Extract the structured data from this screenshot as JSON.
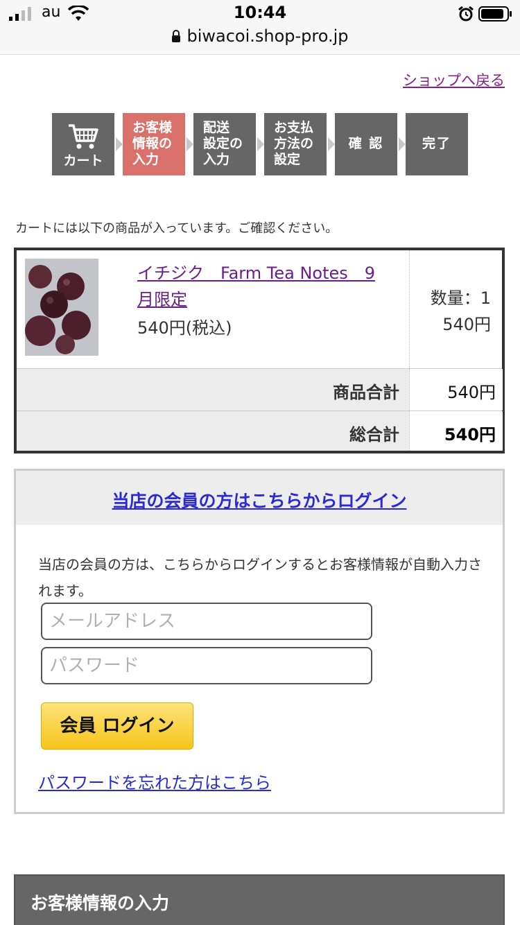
{
  "status_bar": {
    "carrier": "au",
    "time": "10:44",
    "url": "biwacoi.shop-pro.jp"
  },
  "header": {
    "back_link": "ショップへ戻る"
  },
  "steps": [
    {
      "label": "カート"
    },
    {
      "label_lines": [
        "お客様",
        "情報の",
        "入力"
      ],
      "active": true
    },
    {
      "label_lines": [
        "配送",
        "設定の",
        "入力"
      ]
    },
    {
      "label_lines": [
        "お支払",
        "方法の",
        "設定"
      ]
    },
    {
      "label": "確 認"
    },
    {
      "label": "完了"
    }
  ],
  "cart": {
    "intro": "カートには以下の商品が入っています。ご確認ください。",
    "item": {
      "name_line1": "イチジク　Farm Tea Notes　9",
      "name_line2": "月限定",
      "price": "540円(税込)",
      "quantity": "数量：1",
      "subtotal": "540円"
    },
    "product_total_label": "商品合計",
    "product_total_value": "540円",
    "grand_total_label": "総合計",
    "grand_total_value": "540円"
  },
  "login": {
    "heading": "当店の会員の方はこちらからログイン",
    "description": "当店の会員の方は、こちらからログインするとお客様情報が自動入力されます。",
    "email_placeholder": "メールアドレス",
    "password_placeholder": "パスワード",
    "button": "会員 ログイン",
    "forgot": "パスワードを忘れた方はこちら"
  },
  "section": {
    "title": "お客様情報の入力"
  },
  "colors": {
    "step_active": "#d9706a",
    "step_default": "#666666",
    "link_blue": "#2a2ad4",
    "link_purple": "#6a1e8a",
    "button_yellow": "#f6c51a"
  }
}
